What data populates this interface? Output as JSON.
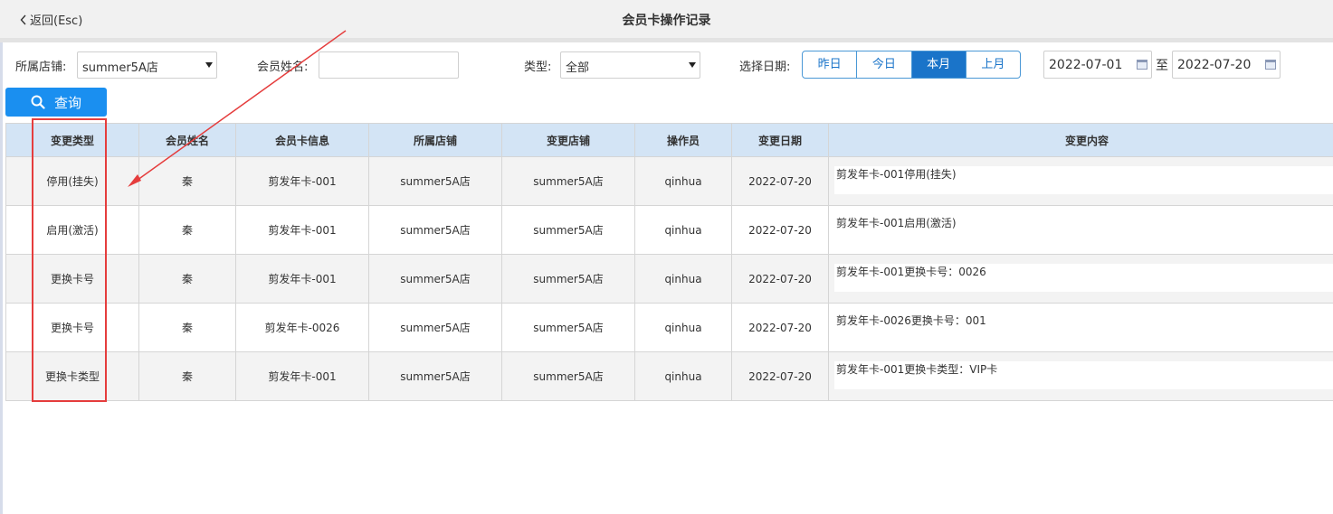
{
  "header": {
    "back_label": "返回(Esc)",
    "title": "会员卡操作记录"
  },
  "filters": {
    "store_label": "所属店铺:",
    "store_value": "summer5A店",
    "member_name_label": "会员姓名:",
    "member_name_value": "",
    "type_label": "类型:",
    "type_value": "全部",
    "date_label": "选择日期:",
    "date_buttons": [
      "昨日",
      "今日",
      "本月",
      "上月"
    ],
    "active_date_button": "本月",
    "date_from": "2022-07-01",
    "date_to_sep": "至",
    "date_to": "2022-07-20",
    "query_label": "查询"
  },
  "table": {
    "headers": [
      "变更类型",
      "会员姓名",
      "会员卡信息",
      "所属店铺",
      "变更店铺",
      "操作员",
      "变更日期",
      "变更内容"
    ],
    "rows": [
      [
        "停用(挂失)",
        "秦",
        "剪发年卡-001",
        "summer5A店",
        "summer5A店",
        "qinhua",
        "2022-07-20",
        "剪发年卡-001停用(挂失)"
      ],
      [
        "启用(激活)",
        "秦",
        "剪发年卡-001",
        "summer5A店",
        "summer5A店",
        "qinhua",
        "2022-07-20",
        "剪发年卡-001启用(激活)"
      ],
      [
        "更换卡号",
        "秦",
        "剪发年卡-001",
        "summer5A店",
        "summer5A店",
        "qinhua",
        "2022-07-20",
        "剪发年卡-001更换卡号：0026"
      ],
      [
        "更换卡号",
        "秦",
        "剪发年卡-0026",
        "summer5A店",
        "summer5A店",
        "qinhua",
        "2022-07-20",
        "剪发年卡-0026更换卡号：001"
      ],
      [
        "更换卡类型",
        "秦",
        "剪发年卡-001",
        "summer5A店",
        "summer5A店",
        "qinhua",
        "2022-07-20",
        "剪发年卡-001更换卡类型：VIP卡"
      ]
    ]
  },
  "annotation": {
    "highlight_color": "#e53d3d"
  },
  "colors": {
    "accent": "#1a8ff0",
    "header_row": "#d3e4f5"
  }
}
